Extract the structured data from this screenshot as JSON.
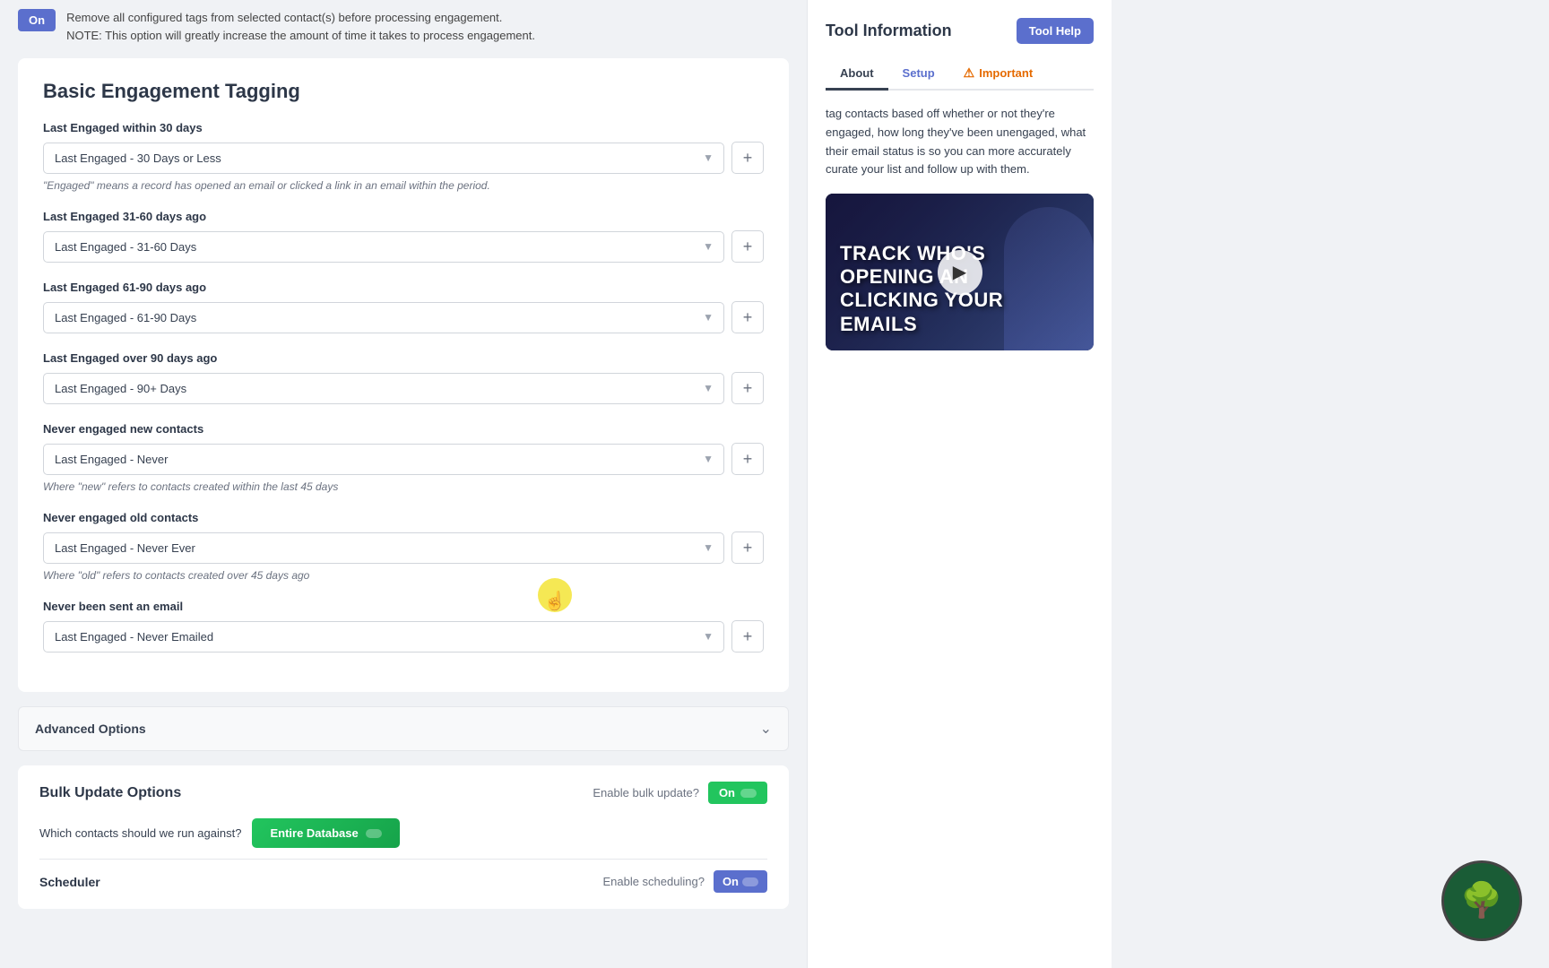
{
  "topStrip": {
    "toggleLabel": "On",
    "line1": "Remove all configured tags from selected contact(s) before processing engagement.",
    "line2": "NOTE: This option will greatly increase the amount of time it takes to process engagement."
  },
  "main": {
    "sectionTitle": "Basic Engagement Tagging",
    "groups": [
      {
        "label": "Last Engaged within 30 days",
        "selectValue": "Last Engaged - 30 Days or Less",
        "hint": "\"Engaged\" means a record has opened an email or clicked a link in an email within the period."
      },
      {
        "label": "Last Engaged 31-60 days ago",
        "selectValue": "Last Engaged - 31-60 Days",
        "hint": ""
      },
      {
        "label": "Last Engaged 61-90 days ago",
        "selectValue": "Last Engaged - 61-90 Days",
        "hint": ""
      },
      {
        "label": "Last Engaged over 90 days ago",
        "selectValue": "Last Engaged - 90+ Days",
        "hint": ""
      },
      {
        "label": "Never engaged new contacts",
        "selectValue": "Last Engaged - Never",
        "hint": "Where \"new\" refers to contacts created within the last 45 days"
      },
      {
        "label": "Never engaged old contacts",
        "selectValue": "Last Engaged - Never Ever",
        "hint": "Where \"old\" refers to contacts created over 45 days ago"
      },
      {
        "label": "Never been sent an email",
        "selectValue": "Last Engaged - Never Emailed",
        "hint": ""
      }
    ],
    "addButtonLabel": "+",
    "advancedOptions": {
      "title": "Advanced Options"
    },
    "bulkUpdate": {
      "title": "Bulk Update Options",
      "enableLabel": "Enable bulk update?",
      "toggleLabel": "On",
      "contactsQuestion": "Which contacts should we run against?",
      "entireDbLabel": "Entire Database",
      "schedulerTitle": "Scheduler",
      "schedulerEnableLabel": "Enable scheduling?",
      "schedulerToggleLabel": "On"
    }
  },
  "sidebar": {
    "title": "Tool Information",
    "toolHelpLabel": "Tool Help",
    "tabs": [
      {
        "label": "About",
        "active": true
      },
      {
        "label": "Setup",
        "active": false
      },
      {
        "label": "Important",
        "active": false,
        "hasIcon": true
      }
    ],
    "bodyText": "tag contacts based off whether or not they're engaged, how long they've been unengaged, what their email status is so you can more accurately curate your list and follow up with them.",
    "video": {
      "headline": "TRACK WHO'S\nOPENING AN\nCLICKING YOUR\nEMAILS"
    }
  },
  "avatar": {
    "symbol": "🌳"
  }
}
